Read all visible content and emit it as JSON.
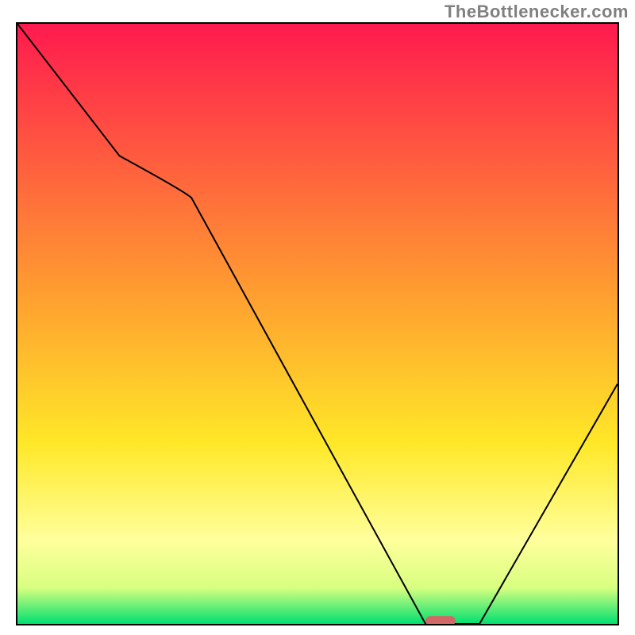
{
  "watermark": "TheBottlenecker.com",
  "chart_data": {
    "type": "line",
    "title": "",
    "xlabel": "",
    "ylabel": "",
    "xlim": [
      0,
      100
    ],
    "ylim": [
      0,
      100
    ],
    "background": {
      "gradient_top_color": "#ff1a4e",
      "gradient_mid_color": "#ffd800",
      "gradient_lowlight_color": "#ffffa0",
      "gradient_bottom_color": "#00e070",
      "gradient_stops": [
        {
          "offset": 0,
          "color": "#ff1a4e"
        },
        {
          "offset": 45,
          "color": "#ff9e30"
        },
        {
          "offset": 70,
          "color": "#ffe828"
        },
        {
          "offset": 86,
          "color": "#ffff9c"
        },
        {
          "offset": 94,
          "color": "#d8ff80"
        },
        {
          "offset": 100,
          "color": "#00e070"
        }
      ]
    },
    "x": [
      0,
      17,
      28,
      68,
      73,
      77,
      100
    ],
    "values": [
      100,
      78,
      72,
      0,
      0,
      0,
      40
    ],
    "marker": {
      "x_range": [
        68,
        73
      ],
      "y": 0.5,
      "color": "#d06868",
      "shape": "rounded"
    }
  }
}
